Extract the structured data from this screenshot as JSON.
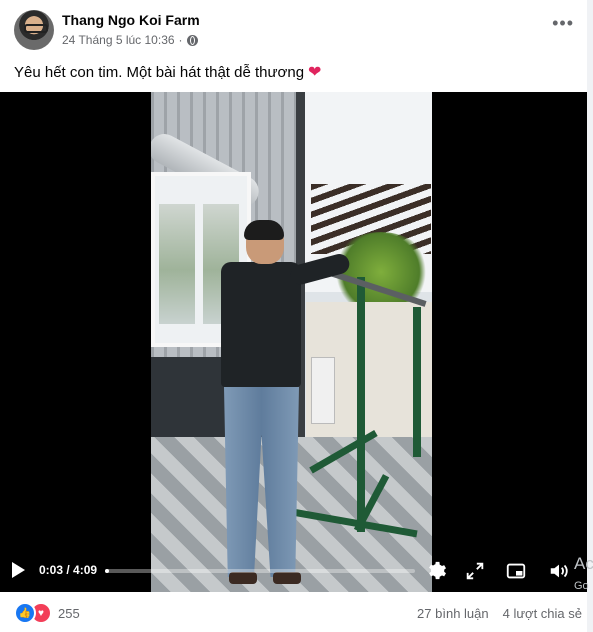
{
  "post": {
    "author": "Thang Ngo Koi Farm",
    "timestamp": "24 Tháng 5 lúc 10:36",
    "separator": "·",
    "caption": "Yêu hết con tim. Một bài hát thật dễ thương",
    "caption_emoji": "❤"
  },
  "video": {
    "time": "0:03 / 4:09",
    "progress": 0.012,
    "icons": [
      "play-icon",
      "settings-icon",
      "fullscreen-icon",
      "pip-icon",
      "volume-icon"
    ]
  },
  "overlay": {
    "text": "Ac",
    "subtext": "Go"
  },
  "footer": {
    "reaction_count": "255",
    "comments": "27 bình luận",
    "shares": "4 lượt chia sẻ"
  },
  "colors": {
    "like": "#1877f2",
    "love": "#f33e58",
    "heart": "#e0245e",
    "rack": "#1f5a36"
  }
}
